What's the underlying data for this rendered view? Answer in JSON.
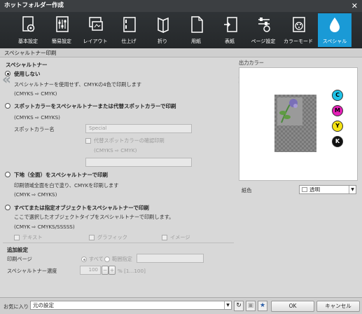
{
  "window": {
    "title": "ホットフォルダー作成"
  },
  "toolbar": {
    "items": [
      {
        "label": "基本設定",
        "icon": "gear-doc-icon"
      },
      {
        "label": "簡易設定",
        "icon": "sliders-doc-icon"
      },
      {
        "label": "レイアウト",
        "icon": "layout-icon"
      },
      {
        "label": "仕上げ",
        "icon": "finishing-icon"
      },
      {
        "label": "折り",
        "icon": "fold-icon"
      },
      {
        "label": "用紙",
        "icon": "paper-icon"
      },
      {
        "label": "表紙",
        "icon": "cover-icon"
      },
      {
        "label": "ページ設定",
        "icon": "page-setup-icon"
      },
      {
        "label": "カラーモード",
        "icon": "palette-icon"
      },
      {
        "label": "スペシャル",
        "icon": "drop-icon",
        "active": true
      }
    ],
    "accent": "#1a9ad6"
  },
  "panel": {
    "title": "スペシャルトナー印刷"
  },
  "special_toner": {
    "heading": "スペシャルトナー",
    "opt_none": {
      "label": "使用しない",
      "desc": "スペシャルトナーを使用せず、CMYKの4色で印刷します",
      "map": "(CMYKS ⇨ CMYK)"
    },
    "opt_spot": {
      "label": "スポットカラーをスペシャルトナーまたは代替スポットカラーで印刷",
      "map": "(CMYKS ⇨ CMYKS)",
      "spot_name_label": "スポットカラー名",
      "spot_name_value": "Special",
      "alt_check": "代替スポットカラーの確認印刷",
      "alt_map": "(CMYKS ⇨ CMYK)"
    },
    "opt_under": {
      "label": "下地（全面）をスペシャルトナーで印刷",
      "desc": "印刷領域全面を白で塗り、CMYKを印刷します",
      "map": "(CMYK ⇨ CMYKS)"
    },
    "opt_objects": {
      "label": "すべてまたは指定オブジェクトをスペシャルトナーで印刷",
      "desc": "ここで選択したオブジェクトタイプをスペシャルトナーで印刷します。",
      "map": "(CMYK ⇨ CMYKS/SSSSS)",
      "checks": [
        "テキスト",
        "グラフィック",
        "イメージ"
      ]
    }
  },
  "additional": {
    "heading": "追加設定",
    "print_pages_label": "印刷ページ",
    "all_label": "すべて",
    "range_label": "範囲指定",
    "density_label": "スペシャルトナー濃度",
    "density_value": "100",
    "density_range": "% [1...100]"
  },
  "output_color": {
    "heading": "出力カラー",
    "inks": [
      {
        "label": "C",
        "color": "#1fc3e8"
      },
      {
        "label": "M",
        "color": "#e51fb8"
      },
      {
        "label": "Y",
        "color": "#f5e313"
      },
      {
        "label": "K",
        "color": "#111111"
      }
    ],
    "paper_color_label": "紙色",
    "paper_color_value": "透明"
  },
  "footer": {
    "favorites_label": "お気に入り",
    "favorites_value": "元の設定",
    "ok": "OK",
    "cancel": "キャンセル"
  }
}
